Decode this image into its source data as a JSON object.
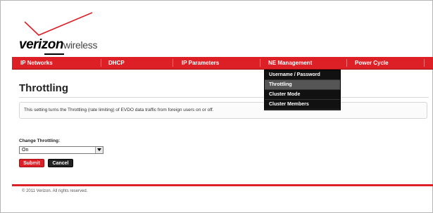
{
  "brand": {
    "name_main": "verizon",
    "name_sub": "wireless"
  },
  "nav": {
    "items": [
      {
        "label": "IP Networks"
      },
      {
        "label": "DHCP"
      },
      {
        "label": "IP Parameters"
      },
      {
        "label": "NE Management"
      },
      {
        "label": "Power Cycle"
      }
    ]
  },
  "dropdown": {
    "items": [
      {
        "label": "Username / Password",
        "active": false
      },
      {
        "label": "Throttling",
        "active": true
      },
      {
        "label": "Cluster Mode",
        "active": false
      },
      {
        "label": "Cluster Members",
        "active": false
      }
    ]
  },
  "main": {
    "title": "Throttling",
    "description": "This setting turns the Throttling (rate limiting) of EVDO data traffic from foreign users on or off."
  },
  "form": {
    "label": "Change Throttling:",
    "select_value": "On",
    "submit_label": "Submit",
    "cancel_label": "Cancel"
  },
  "footer": {
    "text": "© 2011 Verizon. All rights reserved."
  },
  "colors": {
    "brand_red": "#dd1f26",
    "menu_black": "#111111",
    "active_item": "#555555"
  }
}
